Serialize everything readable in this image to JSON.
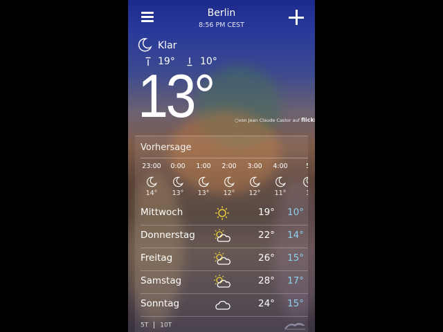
{
  "header": {
    "city": "Berlin",
    "time": "8:56 PM CEST"
  },
  "current": {
    "condition": "Klar",
    "high": "19°",
    "low": "10°",
    "temp": "13°",
    "icon": "moon-icon"
  },
  "credit": {
    "text": "von Jean Claude  Castor auf",
    "brand": "flickr"
  },
  "forecast": {
    "title": "Vorhersage",
    "hourly": [
      {
        "time": "23:00",
        "temp": "14°"
      },
      {
        "time": "0:00",
        "temp": "13°"
      },
      {
        "time": "1:00",
        "temp": "13°"
      },
      {
        "time": "2:00",
        "temp": "12°"
      },
      {
        "time": "3:00",
        "temp": "12°"
      },
      {
        "time": "4:00",
        "temp": "11°"
      },
      {
        "time": "5",
        "temp": "1"
      }
    ],
    "daily": [
      {
        "day": "Mittwoch",
        "icon": "sun-icon",
        "high": "19°",
        "low": "10°"
      },
      {
        "day": "Donnerstag",
        "icon": "partly-cloudy-icon",
        "high": "22°",
        "low": "14°"
      },
      {
        "day": "Freitag",
        "icon": "partly-cloudy-icon",
        "high": "26°",
        "low": "15°"
      },
      {
        "day": "Samstag",
        "icon": "partly-cloudy-icon",
        "high": "28°",
        "low": "17°"
      },
      {
        "day": "Sonntag",
        "icon": "cloud-icon",
        "high": "24°",
        "low": "15°"
      }
    ],
    "range_options": [
      "5T",
      "10T"
    ]
  },
  "colors": {
    "low_temp": "#8fd0f0",
    "sun": "#f2d23a"
  }
}
